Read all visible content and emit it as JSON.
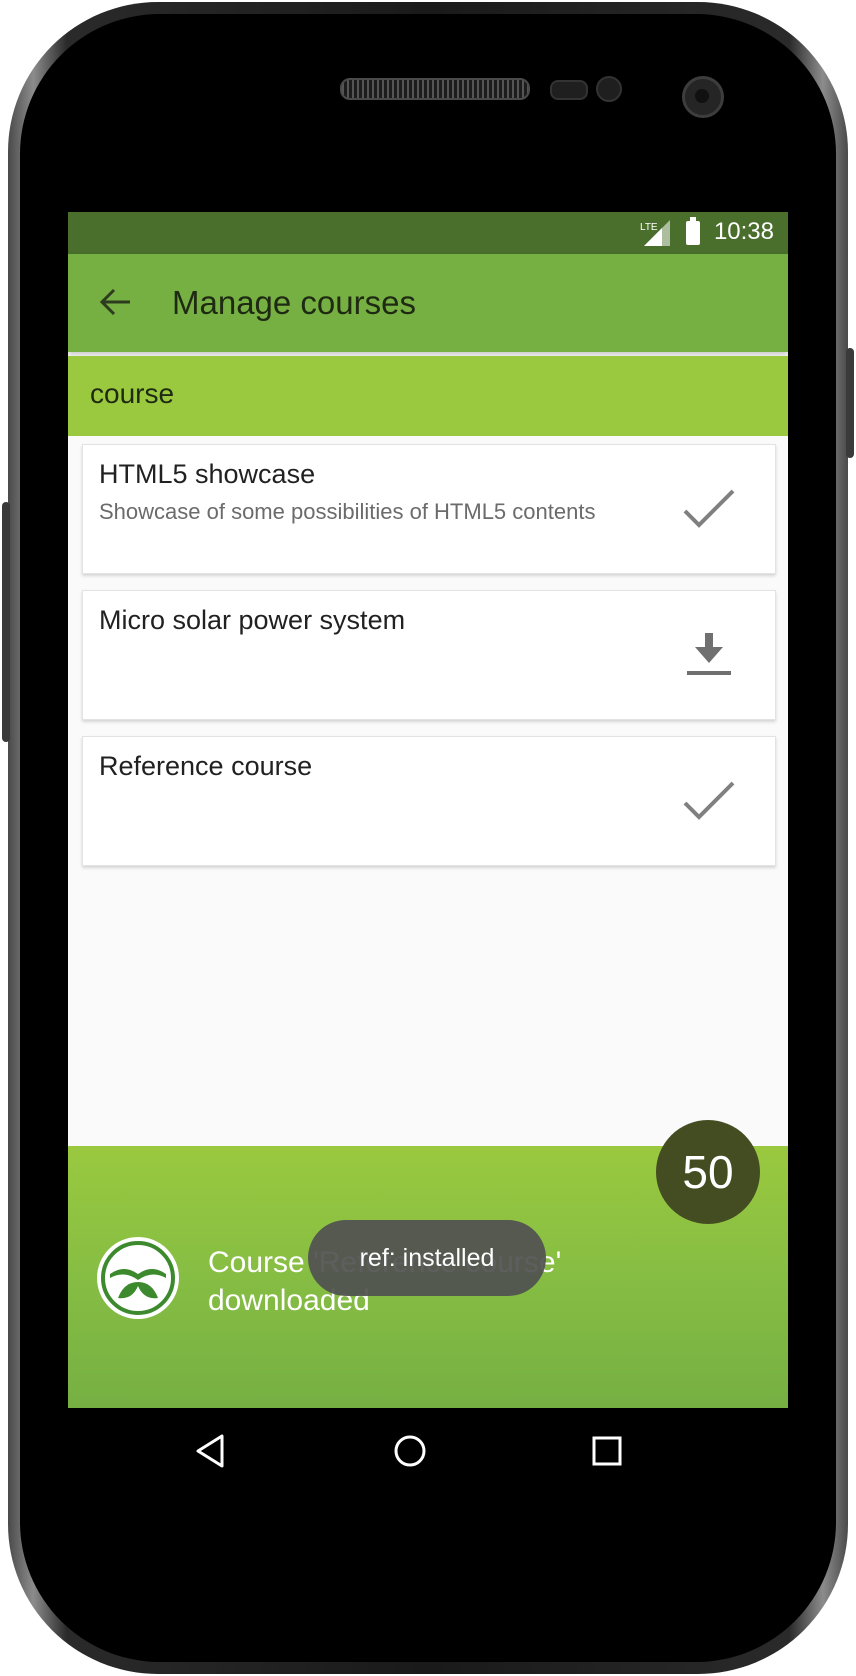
{
  "status_bar": {
    "time": "10:38",
    "network_label": "LTE",
    "icons": [
      "signal-icon",
      "battery-icon"
    ]
  },
  "app_bar": {
    "title": "Manage courses",
    "back_icon": "arrow-left-icon"
  },
  "section": {
    "label": "course"
  },
  "courses": [
    {
      "title": "HTML5 showcase",
      "description": "Showcase of some possibilities of HTML5 contents",
      "status": "installed",
      "icon": "check-icon"
    },
    {
      "title": "Micro solar power system",
      "description": "",
      "status": "available",
      "icon": "download-icon"
    },
    {
      "title": "Reference course",
      "description": "",
      "status": "installed",
      "icon": "check-icon"
    }
  ],
  "download_banner": {
    "message": "Course 'Reference course'\ndownloaded",
    "progress": "50",
    "logo_icon": "book-leaf-logo"
  },
  "toast": {
    "text": "ref: installed"
  },
  "nav_bar": {
    "icons": [
      "back-triangle-icon",
      "home-circle-icon",
      "recents-square-icon"
    ]
  },
  "colors": {
    "status_bar": "#4a6e2b",
    "app_bar": "#76b043",
    "section_header": "#9ac93f",
    "progress_badge": "#444d22"
  }
}
